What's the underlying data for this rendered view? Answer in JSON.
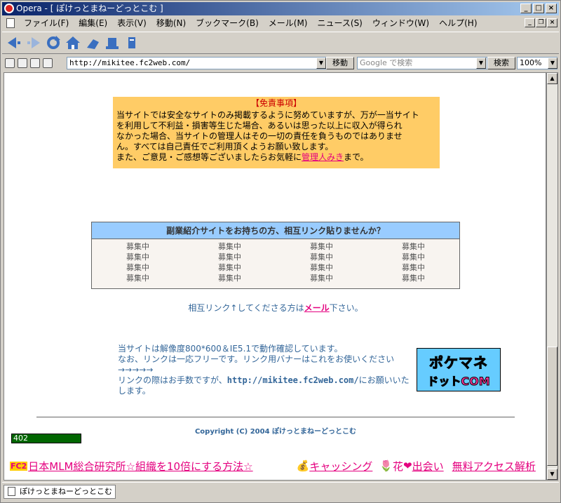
{
  "window": {
    "title": "Opera - [ ぽけっとまねーどっとこむ ]"
  },
  "menubar": [
    "ファイル(F)",
    "編集(E)",
    "表示(V)",
    "移動(N)",
    "ブックマーク(B)",
    "メール(M)",
    "ニュース(S)",
    "ウィンドウ(W)",
    "ヘルプ(H)"
  ],
  "navbar": {
    "icons": [
      "back-icon",
      "forward-icon",
      "reload-icon",
      "home-icon",
      "wand-icon",
      "hotlist-icon",
      "print-icon"
    ]
  },
  "address": {
    "url": "http://mikitee.fc2web.com/",
    "go_label": "移動",
    "search_placeholder": "Google で検索",
    "search_label": "検索",
    "zoom": "100%"
  },
  "page": {
    "disclaimer": {
      "title": "【免責事項】",
      "lines": [
        "当サイトでは安全なサイトのみ掲載するように努めていますが、万が一当サイト",
        "を利用して不利益・損害等生じた場合、あるいは思った以上に収入が得られ",
        "なかった場合、当サイトの管理人はその一切の責任を負うものではありませ",
        "ん。すべては自己責任でご利用頂くようお願い致します。"
      ],
      "last_prefix": "また、ご意見・ご感想等ございましたらお気軽に",
      "last_link": "管理人みき",
      "last_suffix": "まで。"
    },
    "recruit": {
      "heading": "副業紹介サイトをお持ちの方、相互リンク貼りませんか？",
      "cells": [
        "募集中",
        "募集中",
        "募集中",
        "募集中",
        "募集中",
        "募集中",
        "募集中",
        "募集中",
        "募集中",
        "募集中",
        "募集中",
        "募集中",
        "募集中",
        "募集中",
        "募集中",
        "募集中"
      ]
    },
    "mutual": {
      "prefix": "相互リンク↑してくださる方は",
      "link": "メール",
      "suffix": "下さい。"
    },
    "info": {
      "line1": "当サイトは解像度800*600＆IE5.1で動作確認しています。",
      "line2": "なお、リンクは一応フリーです。リンク用バナーはこれをお使いください",
      "line3": "→→→→→",
      "line4_prefix": "リンクの際はお手数ですが、",
      "line4_url": "http://mikitee.fc2web.com/",
      "line4_suffix": "にお願いいた",
      "line5": "します。"
    },
    "banner": {
      "line1": "ポケマネ",
      "line2": "ドットCOM"
    },
    "copyright": "Copyright (C) 2004 ぽけっとまねーどっとこむ",
    "counter": "402",
    "footer": {
      "fc2": "FC2",
      "link1": "日本MLM総合研究所☆組織を10倍にする方法☆",
      "link2": "キャッシング",
      "link3_prefix": "花",
      "link3": "出会い",
      "link4": "無料アクセス解析"
    }
  },
  "status": {
    "tab": "ぽけっとまねーどっとこむ"
  }
}
